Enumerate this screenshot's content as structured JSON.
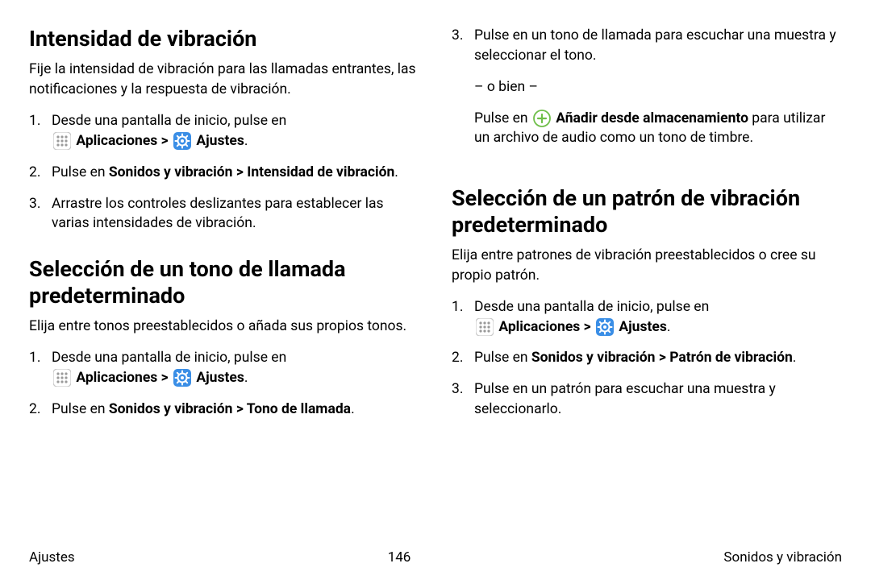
{
  "sec1": {
    "heading": "Intensidad de vibración",
    "intro": "Fije la intensidad de vibración para las llamadas entrantes, las notificaciones y la respuesta de vibración.",
    "step1_a": "Desde una pantalla de inicio, pulse en ",
    "apps": "Aplicaciones",
    "sep": " > ",
    "ajustes": "Ajustes",
    "period": ".",
    "step2_a": "Pulse en ",
    "step2_b": "Sonidos y vibración > Intensidad de vibración",
    "step3": "Arrastre los controles deslizantes para establecer las varias intensidades de vibración."
  },
  "sec2": {
    "heading": "Selección de un tono de llamada predeterminado",
    "intro": "Elija entre tonos preestablecidos o añada sus propios tonos.",
    "step1_a": "Desde una pantalla de inicio, pulse en ",
    "step2_a": "Pulse en ",
    "step2_b": "Sonidos y vibración > Tono de llamada",
    "step3": "Pulse en un tono de llamada para escuchar una muestra y seleccionar el tono.",
    "or": "– o bien –",
    "alt_a": "Pulse en ",
    "alt_b": "Añadir desde almacenamiento",
    "alt_c": " para utilizar un archivo de audio como un tono de timbre."
  },
  "sec3": {
    "heading": "Selección de un patrón de vibración predeterminado",
    "intro": "Elija entre patrones de vibración preestablecidos o cree su propio patrón.",
    "step1_a": "Desde una pantalla de inicio, pulse en ",
    "step2_a": "Pulse en ",
    "step2_b": "Sonidos y vibración > Patrón de vibración",
    "step3": "Pulse en un patrón para escuchar una muestra y seleccionarlo."
  },
  "footer": {
    "left": "Ajustes",
    "center": "146",
    "right": "Sonidos y vibración"
  }
}
